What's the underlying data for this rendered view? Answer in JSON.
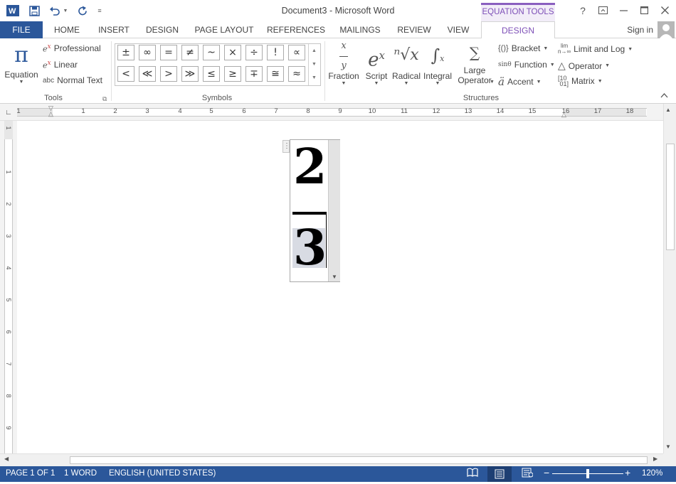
{
  "title_bar": {
    "title": "Document3 - Microsoft Word",
    "context_tab": "EQUATION TOOLS",
    "help": "?"
  },
  "tabs": [
    "FILE",
    "HOME",
    "INSERT",
    "DESIGN",
    "PAGE LAYOUT",
    "REFERENCES",
    "MAILINGS",
    "REVIEW",
    "VIEW",
    "DESIGN"
  ],
  "sign_in": "Sign in",
  "ribbon": {
    "tools": {
      "equation_label": "Equation",
      "professional": "Professional",
      "linear": "Linear",
      "normal_text": "Normal Text",
      "normal_text_icon": "abc",
      "group_label": "Tools"
    },
    "symbols": {
      "row1": [
        "±",
        "∞",
        "=",
        "≠",
        "~",
        "×",
        "÷",
        "!",
        "∝"
      ],
      "row2": [
        "<",
        "≪",
        ">",
        "≫",
        "≤",
        "≥",
        "∓",
        "≅",
        "≈"
      ],
      "group_label": "Symbols"
    },
    "structures": {
      "fraction": "Fraction",
      "script": "Script",
      "radical": "Radical",
      "integral": "Integral",
      "large_operator_1": "Large",
      "large_operator_2": "Operator",
      "bracket": "Bracket",
      "function": "Function",
      "accent": "Accent",
      "limit_and_log": "Limit and Log",
      "operator": "Operator",
      "matrix": "Matrix",
      "group_label": "Structures"
    }
  },
  "ruler": {
    "h_numbers": [
      "1",
      "1",
      "2",
      "3",
      "4",
      "5",
      "6",
      "7",
      "8",
      "9",
      "10",
      "11",
      "12",
      "13",
      "14",
      "15",
      "16",
      "17",
      "18"
    ],
    "v_numbers": [
      "1",
      "1",
      "2",
      "3",
      "4",
      "5",
      "6",
      "7",
      "8",
      "9"
    ]
  },
  "equation": {
    "numerator": "2",
    "denominator": "3"
  },
  "status_bar": {
    "page": "PAGE 1 OF 1",
    "words": "1 WORD",
    "language": "ENGLISH (UNITED STATES)",
    "zoom": "120%"
  },
  "colors": {
    "accent_blue": "#2b579a",
    "context_purple": "#7d4fb7"
  }
}
